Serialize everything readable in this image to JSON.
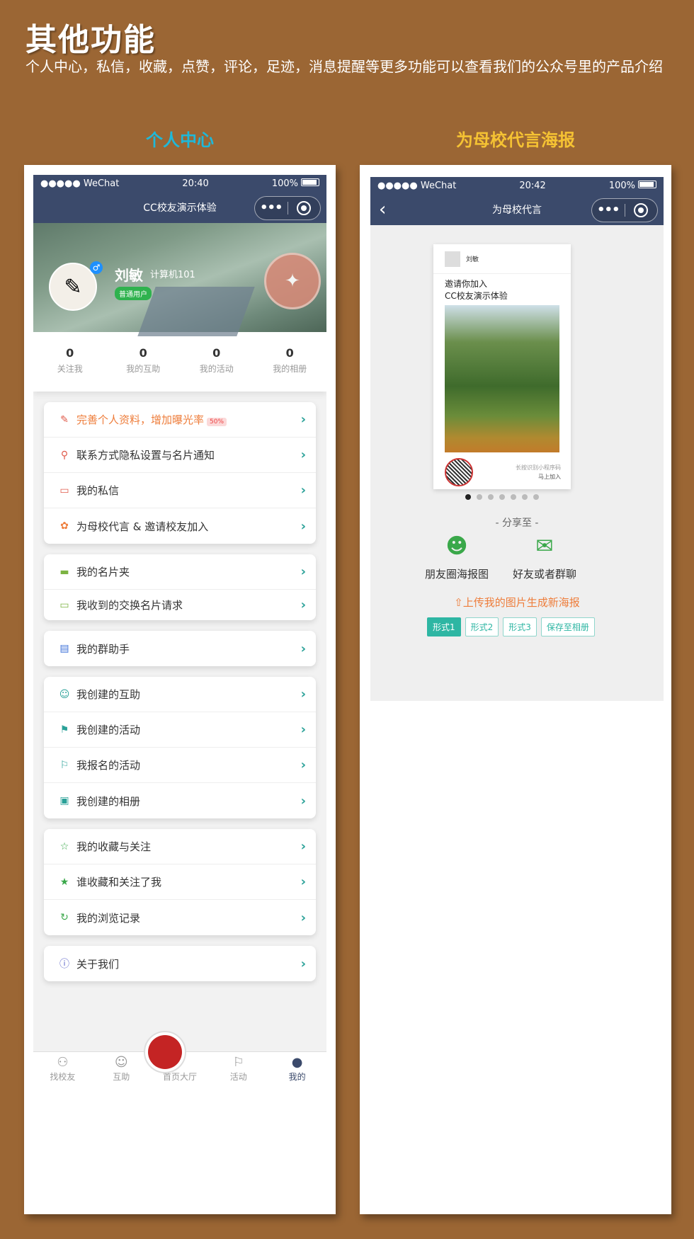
{
  "header": {
    "title": "其他功能",
    "desc": "个人中心，私信，收藏，点赞，评论，足迹，消息提醒等更多功能可以查看我们的公众号里的产品介绍"
  },
  "sections": {
    "left_title": "个人中心",
    "right_title": "为母校代言海报"
  },
  "left_phone": {
    "status": {
      "signal": "●●●●● WeChat",
      "time": "20:40",
      "battery": "100%"
    },
    "nav_title": "CC校友演示体验",
    "profile": {
      "name": "刘敏",
      "class": "计算机101",
      "tag": "普通用户"
    },
    "stats": [
      {
        "num": "0",
        "label": "关注我"
      },
      {
        "num": "0",
        "label": "我的互助"
      },
      {
        "num": "0",
        "label": "我的活动"
      },
      {
        "num": "0",
        "label": "我的相册"
      }
    ],
    "group1": [
      {
        "label": "完善个人资料，增加曝光率",
        "badge": "50%"
      },
      {
        "label": "联系方式隐私设置与名片通知"
      },
      {
        "label": "我的私信"
      },
      {
        "label": "为母校代言 & 邀请校友加入"
      }
    ],
    "group2": [
      {
        "label": "我的名片夹"
      },
      {
        "label": "我收到的交换名片请求"
      }
    ],
    "group3": [
      {
        "label": "我的群助手"
      }
    ],
    "group4": [
      {
        "label": "我创建的互助"
      },
      {
        "label": "我创建的活动"
      },
      {
        "label": "我报名的活动"
      },
      {
        "label": "我创建的相册"
      }
    ],
    "group5": [
      {
        "label": "我的收藏与关注"
      },
      {
        "label": "谁收藏和关注了我"
      },
      {
        "label": "我的浏览记录"
      }
    ],
    "group6": [
      {
        "label": "关于我们"
      }
    ],
    "tabs": [
      {
        "label": "找校友"
      },
      {
        "label": "互助"
      },
      {
        "label": "首页大厅"
      },
      {
        "label": "活动"
      },
      {
        "label": "我的"
      }
    ]
  },
  "right_phone": {
    "status": {
      "signal": "●●●●● WeChat",
      "time": "20:42",
      "battery": "100%"
    },
    "nav_title": "为母校代言",
    "poster": {
      "user": "刘敏",
      "invite_line1": "邀请你加入",
      "invite_line2": "CC校友演示体验",
      "foot_line1": "长按识别小程序码",
      "foot_line2": "马上加入"
    },
    "share_title": "- 分享至 -",
    "share_moments": "朋友圈海报图",
    "share_friends": "好友或者群聊",
    "upload": "上传我的图片生成新海报",
    "styles": [
      "形式1",
      "形式2",
      "形式3",
      "保存至相册"
    ]
  },
  "colors": {
    "background": "#9b6634",
    "nav": "#3b4a6b",
    "accent_teal": "#2eb6a3",
    "left_title": "#1fb8d8",
    "right_title": "#f5c233"
  }
}
